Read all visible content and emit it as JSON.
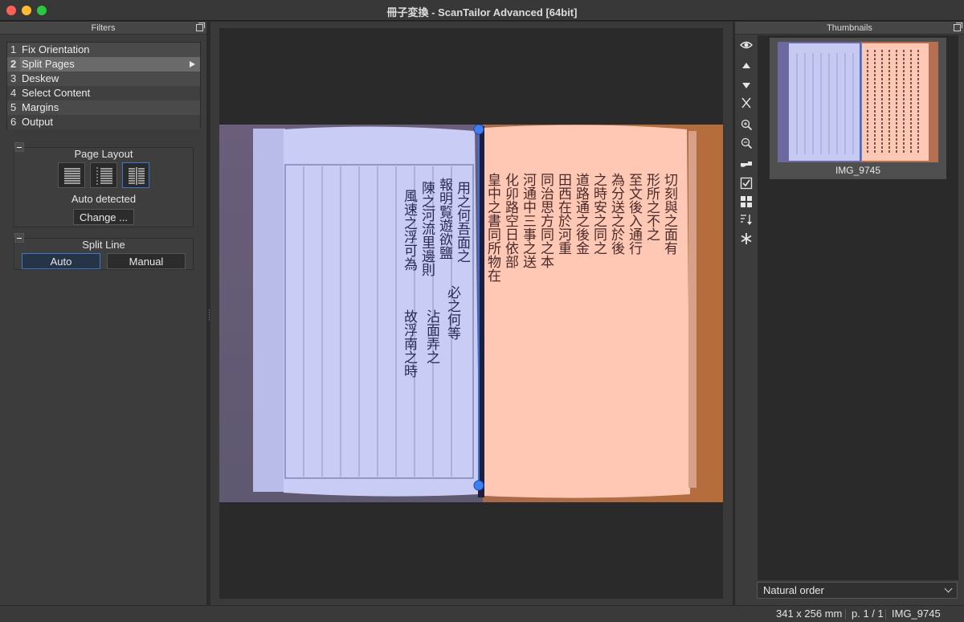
{
  "window": {
    "title": "冊子変換 - ScanTailor Advanced [64bit]"
  },
  "filters_panel": {
    "title": "Filters",
    "items": [
      {
        "num": "1",
        "label": "Fix Orientation"
      },
      {
        "num": "2",
        "label": "Split Pages"
      },
      {
        "num": "3",
        "label": "Deskew"
      },
      {
        "num": "4",
        "label": "Select Content"
      },
      {
        "num": "5",
        "label": "Margins"
      },
      {
        "num": "6",
        "label": "Output"
      }
    ],
    "selected_index": 1
  },
  "page_layout": {
    "title": "Page Layout",
    "buttons": [
      "single-page-uncut-icon",
      "single-page-cut-icon",
      "two-pages-icon"
    ],
    "active_button": "two-pages-icon",
    "status": "Auto detected",
    "change_label": "Change ..."
  },
  "split_line": {
    "title": "Split Line",
    "auto_label": "Auto",
    "manual_label": "Manual",
    "active": "auto"
  },
  "thumbnails_panel": {
    "title": "Thumbnails",
    "items": [
      {
        "label": "IMG_9745"
      }
    ],
    "order": "Natural order",
    "tools": [
      "eye-icon",
      "arrow-up-icon",
      "arrow-down-icon",
      "cut-icon",
      "zoom-in-icon",
      "zoom-out-icon",
      "pointer-icon",
      "checkbox-icon",
      "grid-icon",
      "sort-icon",
      "asterisk-icon"
    ]
  },
  "status_bar": {
    "size": "341 x 256 mm",
    "page": "p. 1 / 1",
    "file": "IMG_9745"
  },
  "colors": {
    "left_page_tint": "#aeb6ff",
    "right_page_tint": "#ffb7a4",
    "split_handle": "#2f6fe8",
    "accent_border": "#3f78c8"
  }
}
